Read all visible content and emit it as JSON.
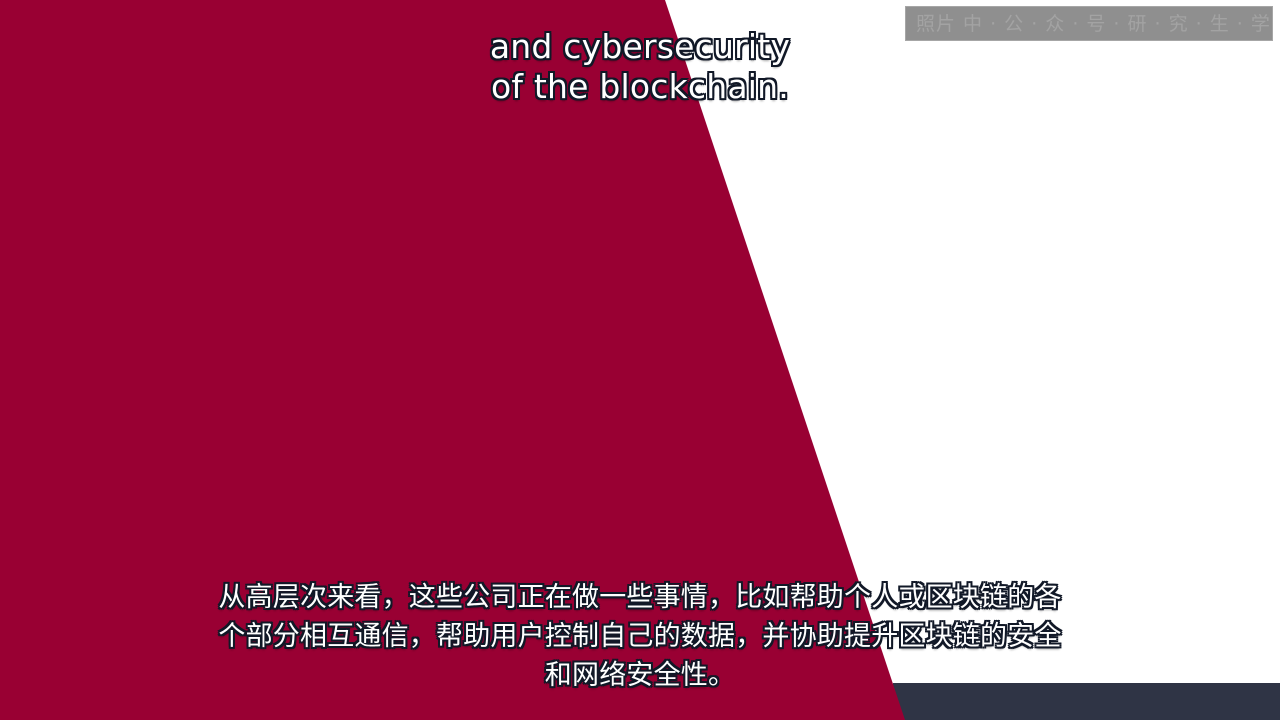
{
  "colors": {
    "crimson_panel": "#990033",
    "white_panel": "#ffffff",
    "dark_strip": "#2f3445",
    "caption_text": "#ffffff",
    "caption_outline": "#111827",
    "watermark_box": "#8f8f8f"
  },
  "watermark": {
    "text": "照片 中 · 公 · 众 · 号 · 研 · 究 · 生 · 学 · 习 · 指 · 南 · 号"
  },
  "captions": {
    "english": {
      "line1": "and cybersecurity",
      "line2": "of the blockchain."
    },
    "chinese": {
      "line1": "从高层次来看，这些公司正在做一些事情，比如帮助个人或区块链的各",
      "line2": "个部分相互通信，帮助用户控制自己的数据，并协助提升区块链的安全",
      "line3": "和网络安全性。"
    }
  }
}
